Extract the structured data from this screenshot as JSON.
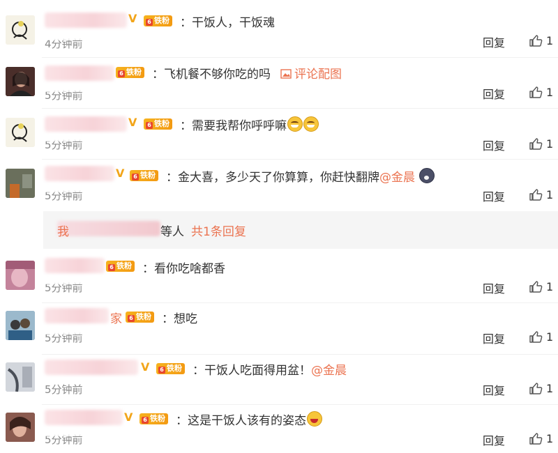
{
  "comments": [
    {
      "text": "：干饭人，干饭魂",
      "time": "4分钟前",
      "reply": "回复",
      "likes": "1",
      "vip": "V"
    },
    {
      "text": "：飞机餐不够你吃的吗",
      "pic_link": "评论配图",
      "time": "5分钟前",
      "reply": "回复",
      "likes": "1"
    },
    {
      "text": "：需要我帮你呼呼嘛",
      "time": "5分钟前",
      "reply": "回复",
      "likes": "1",
      "vip": "V"
    },
    {
      "text": "：金大喜，多少天了你算算，你赶快翻牌",
      "mention": "@金晨",
      "time": "5分钟前",
      "reply": "回复",
      "likes": "1",
      "vip": "V"
    },
    {
      "text": "：看你吃啥都香",
      "time": "5分钟前",
      "reply": "回复",
      "likes": "1"
    },
    {
      "name_tail": "家",
      "text": "：想吃",
      "time": "5分钟前",
      "reply": "回复",
      "likes": "1"
    },
    {
      "text": "：干饭人吃面得用盆！",
      "mention": "@金晨",
      "time": "5分钟前",
      "reply": "回复",
      "likes": "1",
      "vip": "V"
    },
    {
      "text": "：这是干饭人该有的姿态",
      "time": "5分钟前",
      "reply": "回复",
      "likes": "1",
      "vip": "V"
    }
  ],
  "sub_reply": {
    "name_head": "我",
    "suffix": "等人",
    "count_link": "共1条回复"
  },
  "fan_badge": {
    "level": "6",
    "label": "铁粉"
  },
  "colors": {
    "accent": "#eb7350",
    "badge": "#f6b21e",
    "vip": "#f2a51a"
  }
}
